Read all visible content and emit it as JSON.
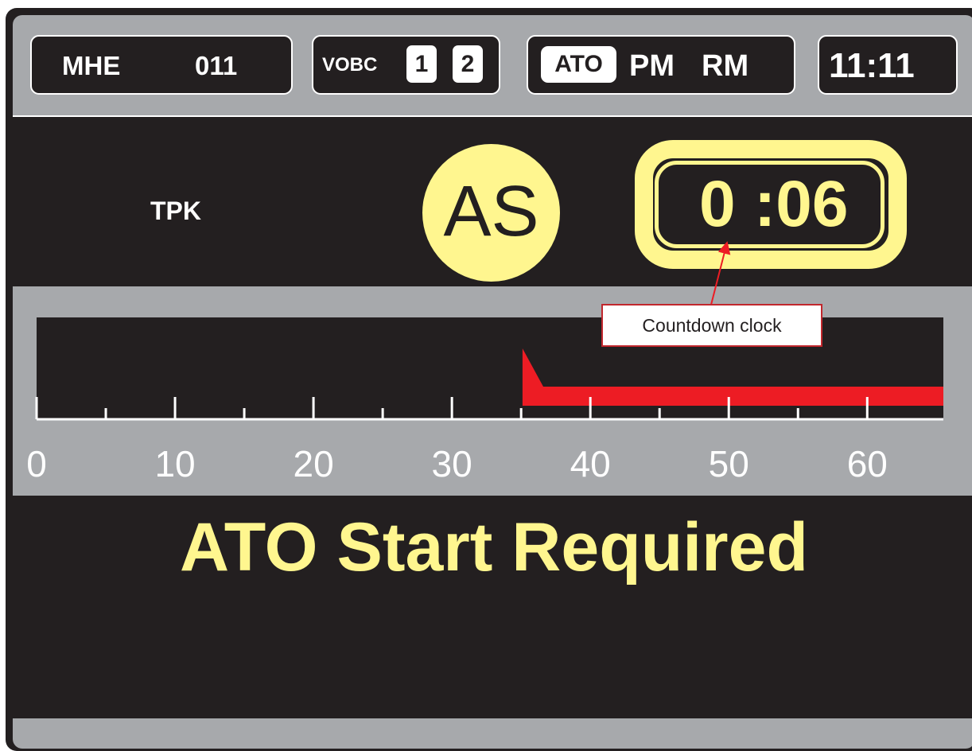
{
  "status_bar": {
    "train_label": "MHE",
    "train_number": "011",
    "vobc_label": "VOBC",
    "vobc_units": [
      "1",
      "2"
    ],
    "modes": [
      "ATO",
      "PM",
      "RM"
    ],
    "active_mode": "ATO",
    "clock": "11:11"
  },
  "station": {
    "code": "TPK",
    "status_badge": "AS",
    "countdown_minutes": "0",
    "countdown_seconds": ":06"
  },
  "annotation": {
    "text": "Countdown clock"
  },
  "gauge": {
    "ticks": [
      "0",
      "10",
      "20",
      "30",
      "40",
      "50",
      "60"
    ],
    "scale_max": 65.5,
    "red_start": 35.1,
    "red_peak_end": 36.6,
    "colors": {
      "bar": "#ed1c24",
      "band": "#231f20",
      "text": "#ffffff"
    }
  },
  "message": {
    "text": "ATO Start Required",
    "color": "#fff68f"
  }
}
